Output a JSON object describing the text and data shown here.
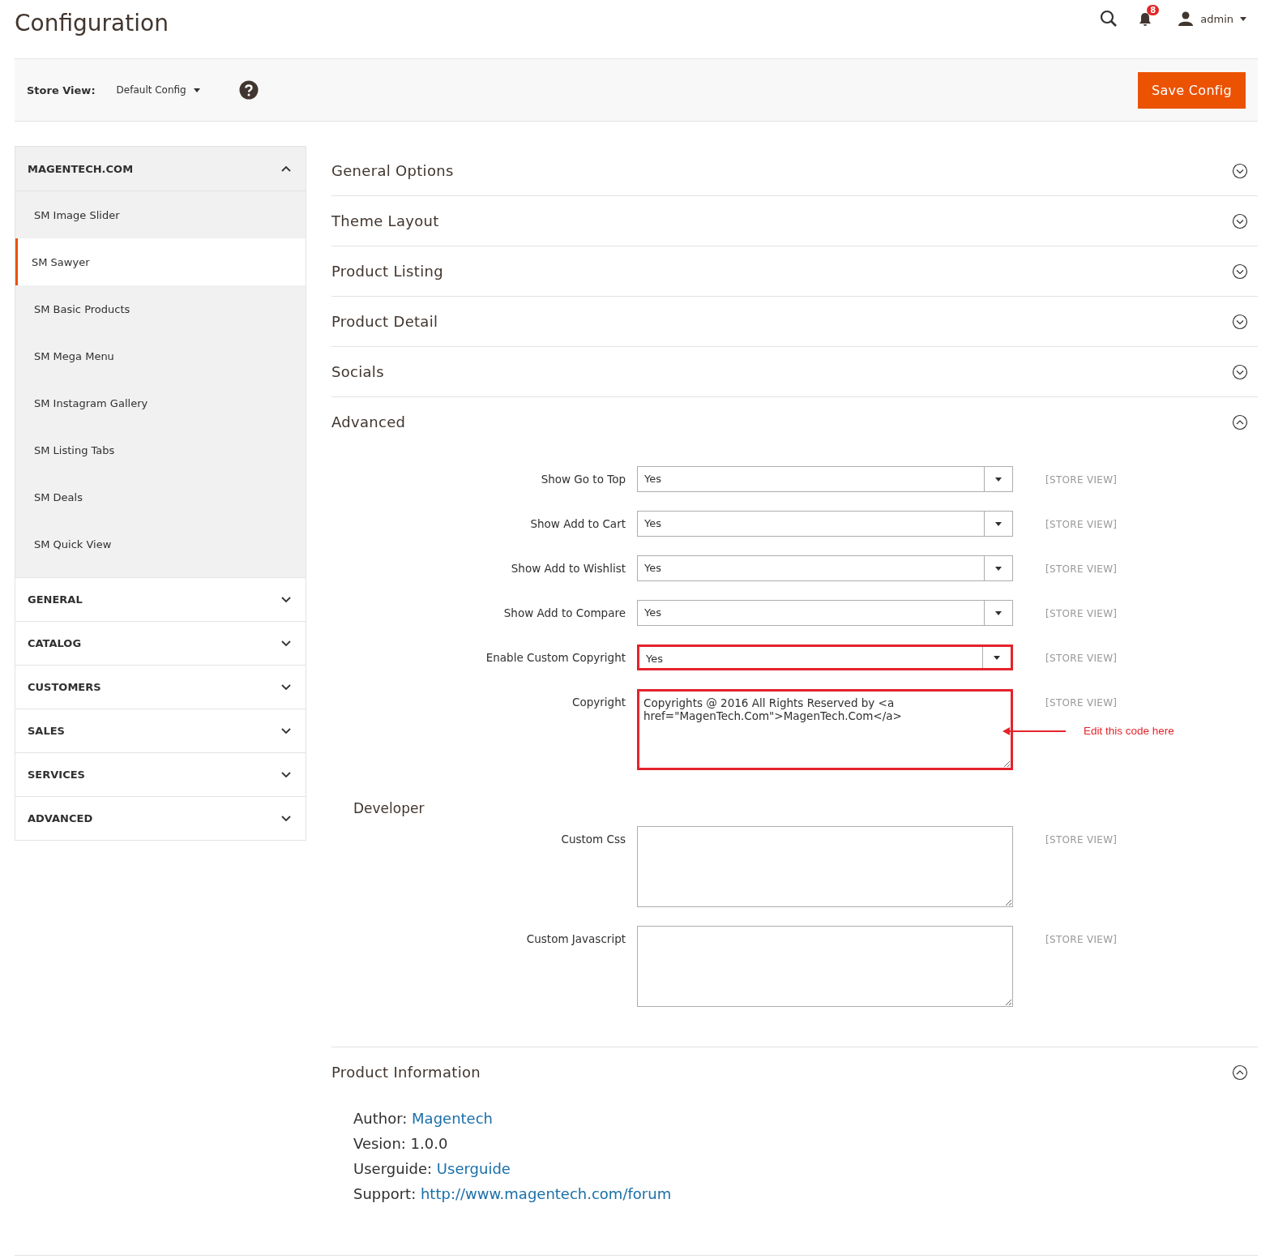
{
  "header": {
    "title": "Configuration",
    "notification_count": "8",
    "user": "admin"
  },
  "store_bar": {
    "label": "Store View:",
    "value": "Default Config",
    "save_button": "Save Config"
  },
  "sidebar": [
    {
      "title": "MAGENTECH.COM",
      "expanded": true,
      "items": [
        {
          "label": "SM Image Slider",
          "selected": false
        },
        {
          "label": "SM Sawyer",
          "selected": true
        },
        {
          "label": "SM Basic Products",
          "selected": false
        },
        {
          "label": "SM Mega Menu",
          "selected": false
        },
        {
          "label": "SM Instagram Gallery",
          "selected": false
        },
        {
          "label": "SM Listing Tabs",
          "selected": false
        },
        {
          "label": "SM Deals",
          "selected": false
        },
        {
          "label": "SM Quick View",
          "selected": false
        }
      ]
    },
    {
      "title": "GENERAL",
      "expanded": false
    },
    {
      "title": "CATALOG",
      "expanded": false
    },
    {
      "title": "CUSTOMERS",
      "expanded": false
    },
    {
      "title": "SALES",
      "expanded": false
    },
    {
      "title": "SERVICES",
      "expanded": false
    },
    {
      "title": "ADVANCED",
      "expanded": false
    }
  ],
  "sections": [
    {
      "title": "General Options",
      "expanded": false
    },
    {
      "title": "Theme Layout",
      "expanded": false
    },
    {
      "title": "Product Listing",
      "expanded": false
    },
    {
      "title": "Product Detail",
      "expanded": false
    },
    {
      "title": "Socials",
      "expanded": false
    },
    {
      "title": "Advanced",
      "expanded": true,
      "groups": [
        {
          "fields": [
            {
              "kind": "select",
              "label": "Show Go to Top",
              "value": "Yes",
              "scope": "[STORE VIEW]",
              "highlighted": false
            },
            {
              "kind": "select",
              "label": "Show Add to Cart",
              "value": "Yes",
              "scope": "[STORE VIEW]",
              "highlighted": false
            },
            {
              "kind": "select",
              "label": "Show Add to Wishlist",
              "value": "Yes",
              "scope": "[STORE VIEW]",
              "highlighted": false
            },
            {
              "kind": "select",
              "label": "Show Add to Compare",
              "value": "Yes",
              "scope": "[STORE VIEW]",
              "highlighted": false
            },
            {
              "kind": "select",
              "label": "Enable Custom Copyright",
              "value": "Yes",
              "scope": "[STORE VIEW]",
              "highlighted": true
            },
            {
              "kind": "textarea",
              "label": "Copyright",
              "value": "Copyrights @ 2016 All Rights Reserved by <a href=\"MagenTech.Com\">MagenTech.Com</a>",
              "scope": "[STORE VIEW]",
              "highlighted": true,
              "annotation": "Edit this code here"
            }
          ]
        },
        {
          "title": "Developer",
          "fields": [
            {
              "kind": "textarea",
              "label": "Custom Css",
              "scope": "[STORE VIEW]",
              "highlighted": false
            },
            {
              "kind": "textarea",
              "label": "Custom Javascript",
              "scope": "[STORE VIEW]",
              "highlighted": false
            }
          ]
        }
      ]
    },
    {
      "title": "Product Information",
      "expanded": true,
      "info": [
        {
          "label": "Author:",
          "value": "Magentech",
          "link": true
        },
        {
          "label": "Vesion:",
          "value": "1.0.0",
          "link": false
        },
        {
          "label": "Userguide:",
          "value": "Userguide",
          "link": true
        },
        {
          "label": "Support:",
          "value": "http://www.magentech.com/forum",
          "link": true
        }
      ]
    }
  ]
}
